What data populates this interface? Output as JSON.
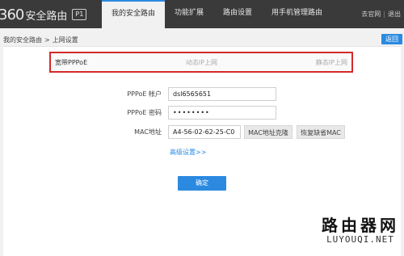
{
  "header": {
    "logo_mark": "360",
    "logo_text": "安全路由",
    "model_badge": "P1",
    "nav": [
      {
        "label": "我的安全路由",
        "active": true
      },
      {
        "label": "功能扩展",
        "active": false
      },
      {
        "label": "路由设置",
        "active": false
      },
      {
        "label": "用手机管理路由",
        "active": false
      }
    ],
    "links": {
      "official": "去官网",
      "separator": "|",
      "logout": "退出"
    }
  },
  "breadcrumb": {
    "root": "我的安全路由",
    "arrow": ">",
    "current": "上网设置"
  },
  "back_button": "返回",
  "tabs": [
    {
      "label": "宽带PPPoE",
      "active": true
    },
    {
      "label": "动态IP上网",
      "active": false
    },
    {
      "label": "静态IP上网",
      "active": false
    }
  ],
  "form": {
    "account_label": "PPPoE 帐户",
    "account_value": "dsl6565651",
    "password_label": "PPPoE 密码",
    "password_value": "••••••••",
    "mac_label": "MAC地址",
    "mac_value": "A4-56-02-62-25-C0",
    "clone_mac_button": "MAC地址克隆",
    "restore_mac_button": "恢复缺省MAC",
    "advanced_link": "高级设置>>",
    "submit_button": "确定"
  },
  "watermark": {
    "title": "路由器网",
    "sub": "LUYOUQI.NET"
  }
}
